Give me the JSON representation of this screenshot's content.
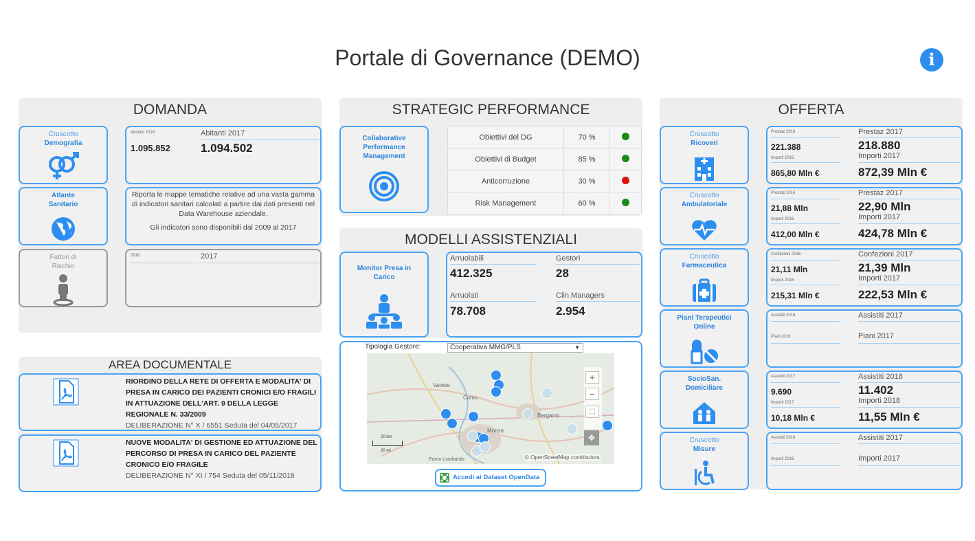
{
  "header": {
    "title": "Portale di Governance (DEMO)",
    "info_icon": "i"
  },
  "domanda": {
    "title": "DOMANDA",
    "demografia": {
      "label1": "Cruscotto",
      "label2": "Demografia",
      "icon": "gender-icon",
      "small_label": "Abitanti 2016",
      "label": "Abitanti 2017",
      "prev_value": "1.095.852",
      "value": "1.094.502"
    },
    "atlante": {
      "label1": "Atlante",
      "label2": "Sanitario",
      "icon": "globe-icon",
      "desc1": "Riporta le mappe tematiche relative ad una vasta gamma di indicatori sanitari calcolati a partire dai dati presenti nel Data Warehouse aziendale.",
      "desc2": "Gli indicatori sono disponibili dal 2009 al 2017"
    },
    "rischio": {
      "label1": "Fattori di",
      "label2": "Rischio",
      "icon": "person-pin-icon",
      "small_label": "2016",
      "label": "2017"
    }
  },
  "documentale": {
    "title": "AREA DOCUMENTALE",
    "docs": [
      {
        "title": "RIORDINO DELLA RETE DI OFFERTA E MODALITA' DI PRESA IN CARICO DEI PAZIENTI CRONICI E/O FRAGILI IN ATTUAZIONE DELL'ART. 9 DELLA LEGGE REGIONALE N. 33/2009",
        "sub": "DELIBERAZIONE N° X / 6551 Seduta del 04/05/2017"
      },
      {
        "title": "NUOVE MODALITA' DI GESTIONE ED ATTUAZIONE DEL PERCORSO DI PRESA IN CARICO DEL PAZIENTE CRONICO E/O FRAGILE",
        "sub": "DELIBERAZIONE N° XI / 754 Seduta del 05/11/2018"
      }
    ]
  },
  "strategic": {
    "title": "STRATEGIC PERFORMANCE",
    "tile": {
      "label": "Collaborative Performance Management",
      "icon": "target-icon"
    },
    "rows": [
      {
        "name": "Obiettivi del DG",
        "value": "70 %",
        "status": "#1a8a1a"
      },
      {
        "name": "Obiettivi di Budget",
        "value": "85 %",
        "status": "#1a8a1a"
      },
      {
        "name": "Anticorruzione",
        "value": "30 %",
        "status": "#e01010"
      },
      {
        "name": "Risk Management",
        "value": "60 %",
        "status": "#1a8a1a"
      }
    ]
  },
  "modelli": {
    "title": "MODELLI ASSISTENZIALI",
    "tile": {
      "label": "Monitor Presa in Carico",
      "icon": "team-icon"
    },
    "arruolabili_label": "Arruolabili",
    "arruolabili": "412.325",
    "gestori_label": "Gestori",
    "gestori": "28",
    "arruolati_label": "Arruolati",
    "arruolati": "78.708",
    "clin_label": "Clin.Managers",
    "clin": "2.954",
    "tipologia_label": "Tipologia Gestore:",
    "tipologia_value": "Cooperativa MMG/PLS",
    "map": {
      "attribution": "© OpenStreetMap contributors.",
      "scale1": "20 km",
      "scale2": "20 mi",
      "cities": [
        "Como",
        "Bergamo",
        "Monza",
        "Varese",
        "Parco Lombardo"
      ]
    },
    "opendata_label": "Accedi ai Dataset OpenData"
  },
  "offerta": {
    "title": "OFFERTA",
    "tiles": [
      {
        "label1": "Cruscotto",
        "label2": "Ricoveri",
        "icon": "hospital-icon",
        "s1": "Prestaz 2016",
        "v1": "221.388",
        "l1": "Prestaz 2017",
        "b1": "218.880",
        "s2": "Importi 2016",
        "v2": "865,80 Mln €",
        "l2": "Importi 2017",
        "b2": "872,39 Mln €"
      },
      {
        "label1": "Cruscotto",
        "label2": "Ambulatoriale",
        "icon": "heartbeat-icon",
        "s1": "Prestaz 2016",
        "v1": "21,88 Mln",
        "l1": "Prestaz 2017",
        "b1": "22,90 Mln",
        "s2": "Importi 2016",
        "v2": "412,00 Mln €",
        "l2": "Importi 2017",
        "b2": "424,78 Mln €"
      },
      {
        "label1": "Cruscotto",
        "label2": "Farmaceutica",
        "icon": "medkit-icon",
        "s1": "Confezioni 2016",
        "v1": "21,11 Mln",
        "l1": "Confezioni 2017",
        "b1": "21,39 Mln",
        "s2": "Importi 2016",
        "v2": "215,31 Mln €",
        "l2": "Importi 2017",
        "b2": "222,53 Mln €"
      },
      {
        "label1": "Piani Terapeutici",
        "label2": "Online",
        "icon": "pills-icon",
        "s1": "Assistiti 2016",
        "v1": "",
        "l1": "Assistiti 2017",
        "b1": "",
        "s2": "Piani 2016",
        "v2": "",
        "l2": "Piani 2017",
        "b2": ""
      },
      {
        "label1": "SocioSan.",
        "label2": "Domiciliare",
        "icon": "home-care-icon",
        "s1": "Assistiti 2017",
        "v1": "9.690",
        "l1": "Assistiti 2018",
        "b1": "11.402",
        "s2": "Importi 2017",
        "v2": "10,18 Mln €",
        "l2": "Importi 2018",
        "b2": "11,55 Mln €"
      },
      {
        "label1": "Cruscotto",
        "label2": "Misure",
        "icon": "accessibility-icon",
        "s1": "Assistiti 2016",
        "v1": "",
        "l1": "Assistiti 2017",
        "b1": "",
        "s2": "Importi 2016",
        "v2": "",
        "l2": "Importi 2017",
        "b2": ""
      }
    ]
  }
}
